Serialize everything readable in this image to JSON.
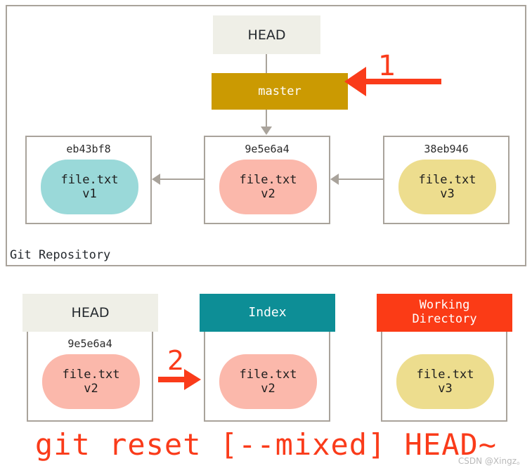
{
  "repository": {
    "label": "Git Repository",
    "head": {
      "label": "HEAD"
    },
    "branch": {
      "label": "master",
      "color": "#cb9a02"
    },
    "commits": [
      {
        "hash": "eb43bf8",
        "file": "file.txt",
        "version": "v1",
        "blob_color": "#9ad9d9"
      },
      {
        "hash": "9e5e6a4",
        "file": "file.txt",
        "version": "v2",
        "blob_color": "#fbb8ab"
      },
      {
        "hash": "38eb946",
        "file": "file.txt",
        "version": "v3",
        "blob_color": "#eddd8e"
      }
    ]
  },
  "annotations": {
    "step_one": "1",
    "step_two": "2",
    "accent_color": "#fa3b1a"
  },
  "areas": [
    {
      "title": "HEAD",
      "title_lines": [
        "HEAD"
      ],
      "header_bg": "#efefe7",
      "header_fg": "#24292e",
      "hash": "9e5e6a4",
      "file": "file.txt",
      "version": "v2",
      "blob_color": "#fbb8ab"
    },
    {
      "title": "Index",
      "title_lines": [
        "Index"
      ],
      "header_bg": "#0d8e96",
      "header_fg": "#ffffff",
      "hash": "",
      "file": "file.txt",
      "version": "v2",
      "blob_color": "#fbb8ab"
    },
    {
      "title": "Working Directory",
      "title_lines": [
        "Working",
        "Directory"
      ],
      "header_bg": "#fb3b16",
      "header_fg": "#ffffff",
      "hash": "",
      "file": "file.txt",
      "version": "v3",
      "blob_color": "#eddd8e"
    }
  ],
  "command": "git reset [--mixed] HEAD~",
  "watermark": "CSDN @Xingz。"
}
